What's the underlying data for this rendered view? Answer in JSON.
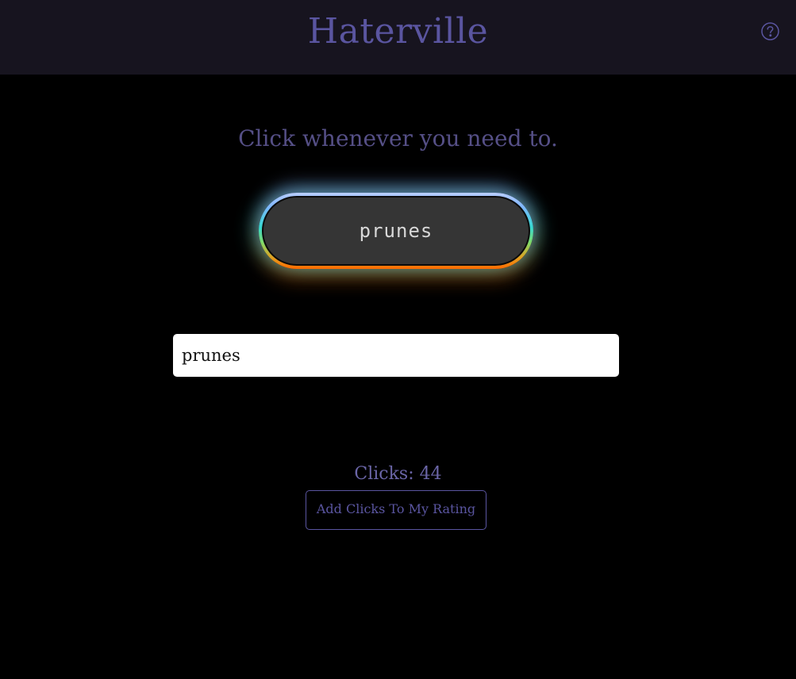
{
  "header": {
    "title": "Haterville",
    "help_icon": "question-circle-icon"
  },
  "main": {
    "prompt": "Click whenever you need to.",
    "click_button_label": "prunes",
    "word_input_value": "prunes",
    "clicks_label": "Clicks:",
    "clicks_count": "44",
    "add_button_label": "Add Clicks To My Rating"
  },
  "colors": {
    "header_bg": "#17141f",
    "page_bg": "#000000",
    "accent": "#5a55a0",
    "button_bg": "#353535"
  }
}
